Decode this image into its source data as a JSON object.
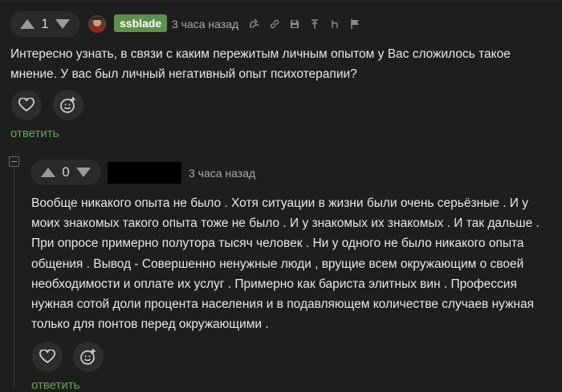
{
  "comment1": {
    "vote_count": "1",
    "username": "ssblade",
    "time": "3 часа назад",
    "text": "Интересно узнать, в связи с каким пережитым личным опытом у Вас сложилось такое мнение. У вас был личный негативный опыт психотерапии?",
    "reply_label": "ответить",
    "toolbar_icons": [
      "branch-icon",
      "link-icon",
      "save-icon",
      "up-arrow-icon",
      "hide-icon",
      "flag-icon"
    ]
  },
  "comment2": {
    "vote_count": "0",
    "time": "3 часа назад",
    "text": "Вообще никакого опыта не было . Хотя ситуации в жизни были очень серьёзные . И у моих знакомых такого опыта тоже не было . И у знакомых их знакомых . И так дальше . При опросе примерно полутора тысяч человек . Ни у одного не было никакого опыта общения . Вывод - Совершенно ненужные люди , врущие всем окружающим о своей необходимости и оплате их услуг . Примерно как бариста элитных вин . Профессия нужная сотой доли процента населения и в подавляющем количестве случаев нужная только для понтов перед окружающими .",
    "reply_label": "ответить"
  },
  "colors": {
    "background": "#1e1e1e",
    "accent_green": "#6aa15b",
    "badge_green": "#5f8f4e",
    "text": "#e8e8e8",
    "muted": "#a9a9a9"
  }
}
